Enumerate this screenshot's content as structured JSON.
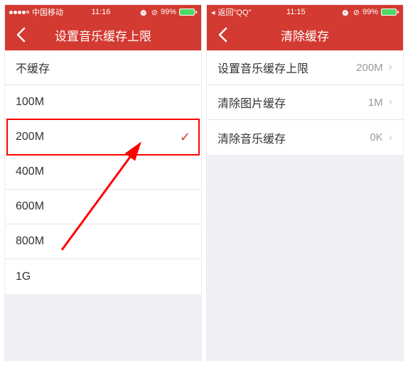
{
  "left": {
    "status": {
      "carrier": "中国移动",
      "time": "11:16",
      "battery": "99%"
    },
    "nav": {
      "title": "设置音乐缓存上限"
    },
    "options": [
      {
        "label": "不缓存",
        "selected": false
      },
      {
        "label": "100M",
        "selected": false
      },
      {
        "label": "200M",
        "selected": true
      },
      {
        "label": "400M",
        "selected": false
      },
      {
        "label": "600M",
        "selected": false
      },
      {
        "label": "800M",
        "selected": false
      },
      {
        "label": "1G",
        "selected": false
      }
    ]
  },
  "right": {
    "status": {
      "back": "返回\"QQ\"",
      "time": "11:15",
      "battery": "99%"
    },
    "nav": {
      "title": "清除缓存"
    },
    "rows": [
      {
        "label": "设置音乐缓存上限",
        "value": "200M"
      },
      {
        "label": "清除图片缓存",
        "value": "1M"
      },
      {
        "label": "清除音乐缓存",
        "value": "0K"
      }
    ]
  }
}
